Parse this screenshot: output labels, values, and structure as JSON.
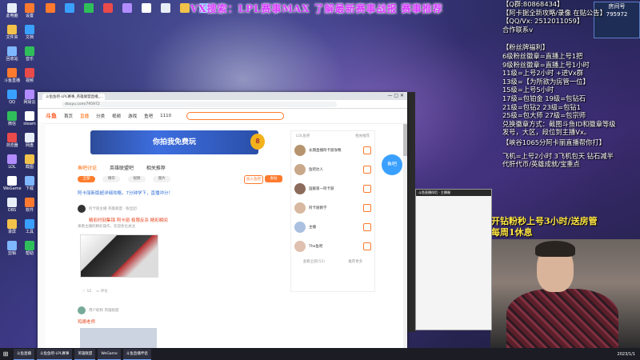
{
  "banner": "VX搜索：LPL赛事MAX  了解最新赛事战报 赛事推荐",
  "room_logo": {
    "line1": "房间号",
    "line2": "795972"
  },
  "side_panel": {
    "lines": [
      "【Q群:80868434】",
      "【阿卡据全新攻略/录像 在贴公告】",
      "【QQ/Vx: 2512011059】",
      "合作联系v",
      "【粉丝牌福利】",
      "6级粉丝徽章=直播上号1把",
      "9级粉丝徽章=直播上号1小时",
      "11级=上号2小时 +进Vx群",
      "13级=【为所欲为房管一位】",
      "15级=上号5小时",
      "17级=包铂金  19级=包钻石",
      "21级=包钻2  23级=包钻1",
      "25级=包大师  27级=包宗师",
      "兑换徽章方式：截图斗鱼ID和徽章等级",
      "发号，大区，段位到主播Vx。",
      "【峡谷1065分阿卡丽直播帮你打】",
      "飞机=上号2小时 3飞机包天 钻石减半",
      "代肝代币/英雄成就/宝重点"
    ]
  },
  "promo": {
    "line1": "开钻粉秒上号3小时/送房管",
    "line2": "每周1休息"
  },
  "browser": {
    "tab_title": "斗鱼鱼吧-LPL赛事_英雄联盟直播_...",
    "address": "douyu.com/795972",
    "nav": {
      "logo": "斗鱼",
      "items": [
        "首页",
        "直播",
        "分类",
        "视频",
        "游戏",
        "鱼吧",
        "1110"
      ]
    },
    "game_banner": "你拍我免费玩",
    "coin_left": "8",
    "coin_right": "8",
    "section_tabs": [
      "鱼吧讨论",
      "英雄联盟吧",
      "相关推荐"
    ],
    "pills": [
      "全部",
      "精华",
      "视频",
      "图片"
    ],
    "btn_join": "加入鱼吧",
    "btn_post": "发帖",
    "notice": "阿卡丽新版超详细攻略，7分钟学下，直播冲分！",
    "post": {
      "user": "阿卡丽主播",
      "user_meta": "英雄联盟 · 粉丝团",
      "title": "精彩时刻集锦 阿卡丽 极限反杀 精彩瞬间",
      "sub": "来看主播的精彩操作，欢迎各位关注",
      "likes": "12",
      "comments": "评论"
    },
    "post2": {
      "user": "用户昵称",
      "meta": "英雄联盟",
      "title": "鸡眼老师"
    },
    "right_col": {
      "head_left": "LOL鱼吧",
      "head_right": "相关推荐",
      "items": [
        "长期直播阿卡丽攻略",
        "鱼吧达人",
        "国服第一阿卡丽",
        "阿卡丽教学",
        "主播",
        "The鱼吧"
      ],
      "foot_left": "查看全部(53)",
      "foot_right": "推荐更多"
    },
    "float_logo": "鱼吧"
  },
  "bg_window": {
    "title": "斗鱼直播伴侣 · 主播端"
  },
  "desktop_icons": [
    "此电脑",
    "文件夹",
    "回收站",
    "斗鱼直播",
    "QQ",
    "微信",
    "浏览器",
    "LOL",
    "WeGame",
    "OBS",
    "录屏",
    "剪辑",
    "设置",
    "文档",
    "音乐",
    "视频",
    "网易云",
    "steam",
    "网盘",
    "截图",
    "下载",
    "软件",
    "工具",
    "帮助"
  ],
  "taskbar": {
    "start": "⊞",
    "items": [
      "斗鱼直播",
      "斗鱼鱼吧-LPL赛事",
      "英雄联盟",
      "WeGame",
      "斗鱼直播伴侣"
    ],
    "clock": "2023/1/1"
  }
}
